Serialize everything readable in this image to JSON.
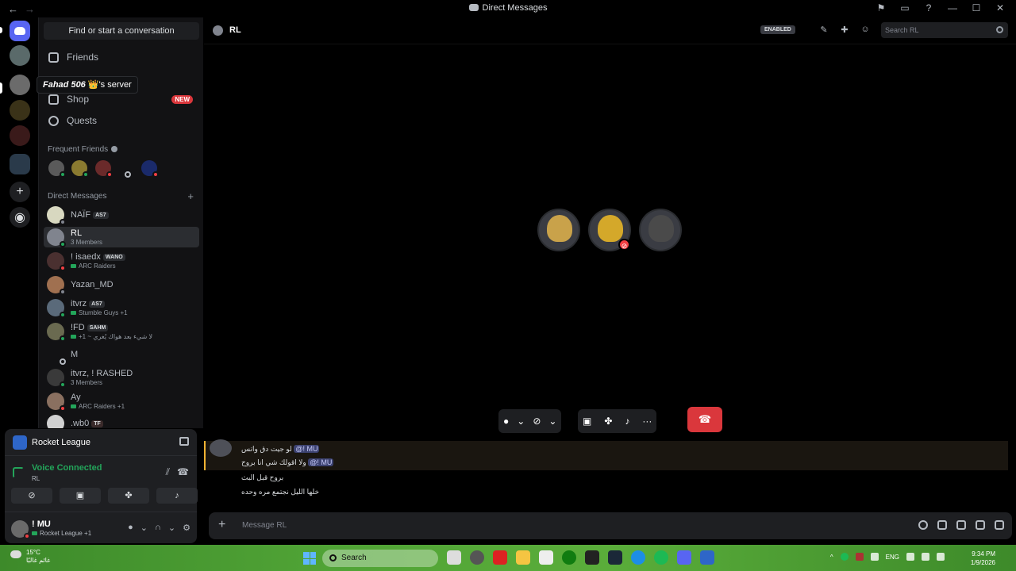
{
  "window": {
    "title": "Direct Messages",
    "nav_back": "←",
    "nav_forward": "→",
    "controls": {
      "inbox": "⚑",
      "help": "?",
      "minimize": "—",
      "maximize": "☐",
      "close": "✕"
    }
  },
  "tooltip": {
    "server_name": "Fahad 506",
    "emoji": "👑",
    "suffix": "'s server"
  },
  "sidebar": {
    "search_label": "Find or start a conversation",
    "nav": [
      {
        "label": "Friends",
        "icon": "friends-icon"
      },
      {
        "label": "Shop",
        "icon": "shop-icon",
        "badge": "NEW"
      },
      {
        "label": "Quests",
        "icon": "quests-icon"
      }
    ],
    "frequent_friends_label": "Frequent Friends",
    "direct_messages_label": "Direct Messages",
    "add_dm": "+",
    "dms": [
      {
        "name": "NAÏF",
        "tag": "AS7",
        "sub": ""
      },
      {
        "name": "RL",
        "tag": "",
        "sub": "3 Members"
      },
      {
        "name": "! isaedx",
        "tag": "WANO",
        "sub": "ARC Raiders"
      },
      {
        "name": "Yazan_MD",
        "tag": "",
        "sub": ""
      },
      {
        "name": "itvrz",
        "tag": "AS7",
        "sub": "Stumble Guys +1"
      },
      {
        "name": "!FD",
        "tag": "SAHM",
        "sub": "+1 ~ لا شيء بعد هواك يُغري"
      },
      {
        "name": "M",
        "tag": "",
        "sub": ""
      },
      {
        "name": "itvrz, ! RASHED",
        "tag": "",
        "sub": "3 Members"
      },
      {
        "name": "Ay",
        "tag": "",
        "sub": "ARC Raiders +1"
      },
      {
        "name": ".wb0",
        "tag": "TF",
        "sub": ""
      }
    ]
  },
  "panel": {
    "activity": "Rocket League",
    "voice_status": "Voice Connected",
    "voice_channel": "RL",
    "user_name": "! MU",
    "user_activity": "Rocket League +1"
  },
  "header": {
    "channel": "RL",
    "enabled_badge": "ENABLED",
    "search_placeholder": "Search RL"
  },
  "call": {
    "controls": {
      "more": "···",
      "hangup": "☎"
    }
  },
  "chat": {
    "messages": [
      {
        "text": "لو جيت دق واتس",
        "mention": "@! MU"
      },
      {
        "text": "ولا اقولك شي انا بروح",
        "mention": "@! MU"
      },
      {
        "text": "بروح قبل البث",
        "mention": ""
      },
      {
        "text": "خلها الليل نجتمع مره وحده",
        "mention": ""
      }
    ],
    "composer_placeholder": "Message RL",
    "composer_plus": "+"
  },
  "taskbar": {
    "temperature": "15°C",
    "weather_text": "غائم غالبًا",
    "search_label": "Search",
    "language": "ENG",
    "time": "9:34 PM",
    "date": "1/9/2026"
  },
  "colors": {
    "accent": "#5865f2",
    "online": "#23a55a",
    "dnd": "#f23f43",
    "hangup": "#da373c"
  }
}
